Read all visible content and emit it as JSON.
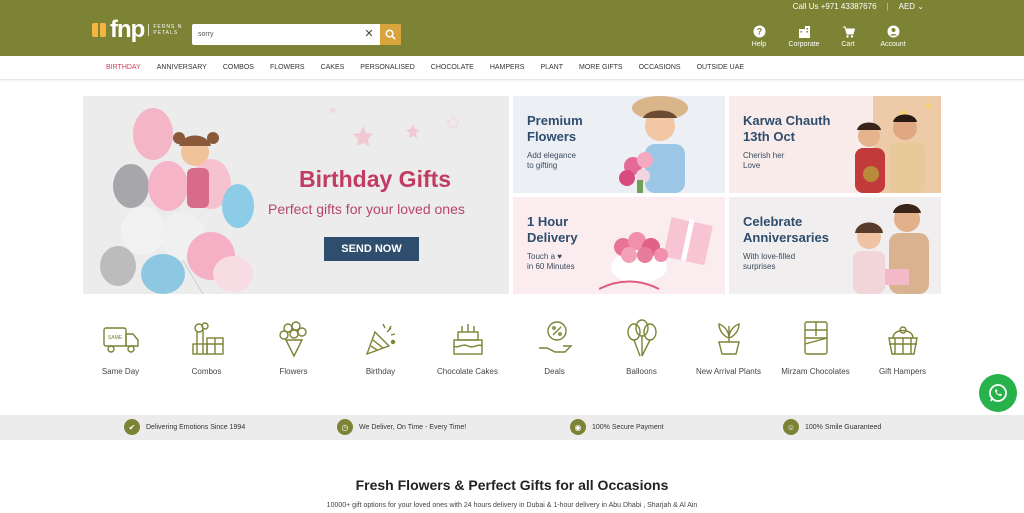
{
  "header": {
    "phone": "Call Us +971 43387676",
    "currency": "AED",
    "brand": "fnp",
    "brand_sub": "FERNS N PETALS",
    "search": {
      "value": "sorry",
      "placeholder": "Search"
    },
    "icons": [
      {
        "label": "Help",
        "icon": "help-icon"
      },
      {
        "label": "Corporate",
        "icon": "corporate-icon"
      },
      {
        "label": "Cart",
        "icon": "cart-icon"
      },
      {
        "label": "Account",
        "icon": "account-icon"
      }
    ],
    "colors": {
      "brand": "#7c8335",
      "accent": "#d9a43b",
      "active": "#d23f57"
    }
  },
  "nav": {
    "items": [
      "BIRTHDAY",
      "ANNIVERSARY",
      "COMBOS",
      "FLOWERS",
      "CAKES",
      "PERSONALISED",
      "CHOCOLATE",
      "HAMPERS",
      "PLANT",
      "MORE GIFTS",
      "OCCASIONS",
      "OUTSIDE UAE"
    ],
    "active": "BIRTHDAY"
  },
  "hero": {
    "title": "Birthday Gifts",
    "subtitle": "Perfect gifts for your loved ones",
    "cta": "SEND NOW"
  },
  "tiles": [
    {
      "title_line1": "Premium",
      "title_line2": "Flowers",
      "text_line1": "Add elegance",
      "text_line2": "to gifting"
    },
    {
      "title_line1": "Karwa Chauth",
      "title_line2": "13th Oct",
      "text_line1": "Cherish her",
      "text_line2": "Love"
    },
    {
      "title_line1": "1 Hour",
      "title_line2": "Delivery",
      "text_line1": "Touch a ♥",
      "text_line2": "in 60 Minutes"
    },
    {
      "title_line1": "Celebrate",
      "title_line2": "Anniversaries",
      "text_line1": "With love-filled",
      "text_line2": "surprises"
    }
  ],
  "quick_categories": [
    {
      "label": "Same Day",
      "icon": "delivery-van-icon"
    },
    {
      "label": "Combos",
      "icon": "combo-gift-icon"
    },
    {
      "label": "Flowers",
      "icon": "bouquet-icon"
    },
    {
      "label": "Birthday",
      "icon": "party-popper-icon"
    },
    {
      "label": "Chocolate Cakes",
      "icon": "cake-icon"
    },
    {
      "label": "Deals",
      "icon": "discount-hand-icon"
    },
    {
      "label": "Balloons",
      "icon": "balloons-icon"
    },
    {
      "label": "New Arrival Plants",
      "icon": "plant-icon"
    },
    {
      "label": "Mirzam Chocolates",
      "icon": "chocolate-bar-icon"
    },
    {
      "label": "Gift Hampers",
      "icon": "hamper-icon"
    }
  ],
  "trust": [
    {
      "label": "Delivering Emotions Since 1994",
      "icon": "thumbs-up-icon"
    },
    {
      "label": "We Deliver, On Time - Every Time!",
      "icon": "clock-icon"
    },
    {
      "label": "100% Secure Payment",
      "icon": "secure-icon"
    },
    {
      "label": "100% Smile Guaranteed",
      "icon": "smile-icon"
    }
  ],
  "section": {
    "title": "Fresh Flowers & Perfect Gifts for all Occasions",
    "subtitle": "10000+ gift options for your loved ones with 24 hours delivery in Dubai & 1-hour delivery in Abu Dhabi , Sharjah & Al Ain"
  }
}
